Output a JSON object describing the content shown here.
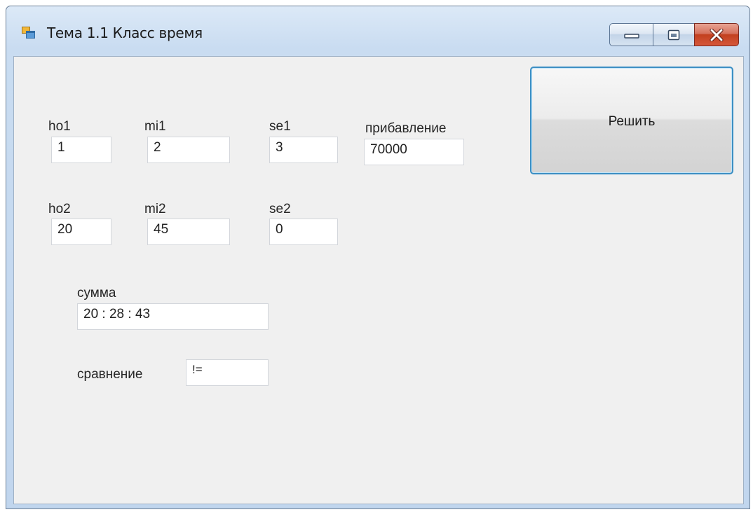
{
  "window": {
    "title": "Тема 1.1 Класс время",
    "icon": "form-icon",
    "controls": [
      "minimize-icon",
      "maximize-icon",
      "close-icon"
    ]
  },
  "fields": {
    "ho1": {
      "label": "ho1",
      "value": "1"
    },
    "mi1": {
      "label": "mi1",
      "value": "2"
    },
    "se1": {
      "label": "se1",
      "value": "3"
    },
    "add": {
      "label": "прибавление",
      "value": "70000"
    },
    "ho2": {
      "label": "ho2",
      "value": "20"
    },
    "mi2": {
      "label": "mi2",
      "value": "45"
    },
    "se2": {
      "label": "se2",
      "value": "0"
    },
    "sum": {
      "label": "сумма",
      "value": "20 : 28 : 43"
    },
    "compare": {
      "label": "сравнение",
      "value": "!="
    }
  },
  "buttons": {
    "solve": "Решить"
  },
  "colors": {
    "window_frame": "#c9dcf1",
    "client_bg": "#f0f0f0",
    "button_focus_border": "#3c8fc4",
    "close_button": "#c2401f"
  }
}
